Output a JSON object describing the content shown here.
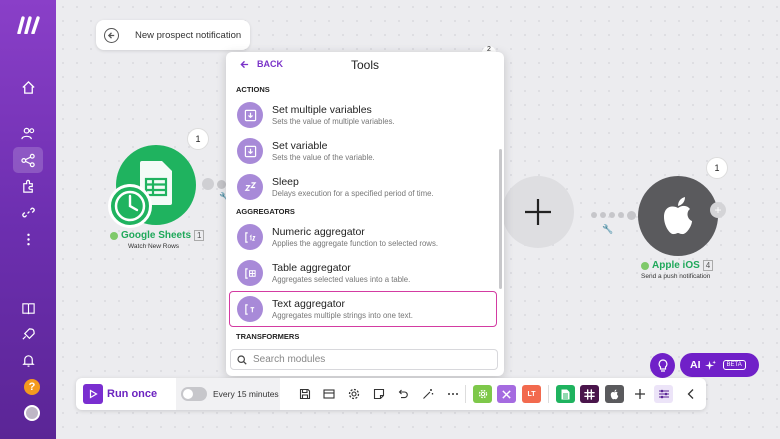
{
  "scenario": {
    "title": "New prospect notification"
  },
  "tools_panel": {
    "back_label": "BACK",
    "title": "Tools",
    "sections": [
      {
        "label": "ACTIONS"
      },
      {
        "label": "AGGREGATORS"
      },
      {
        "label": "TRANSFORMERS"
      }
    ],
    "items": [
      {
        "title": "Set multiple variables",
        "desc": "Sets the value of multiple variables."
      },
      {
        "title": "Set variable",
        "desc": "Sets the value of the variable."
      },
      {
        "title": "Sleep",
        "desc": "Delays execution for a specified period of time."
      },
      {
        "title": "Numeric aggregator",
        "desc": "Applies the aggregate function to selected rows."
      },
      {
        "title": "Table aggregator",
        "desc": "Aggregates selected values into a table."
      },
      {
        "title": "Text aggregator",
        "desc": "Aggregates multiple strings into one text."
      }
    ],
    "selected_item": "Text aggregator",
    "search_placeholder": "Search modules",
    "hidden_badge": "2"
  },
  "nodes": {
    "google_sheets": {
      "name": "Google Sheets",
      "num": "1",
      "sub": "Watch New Rows",
      "badge": "1"
    },
    "apple_ios": {
      "name": "Apple iOS",
      "num": "4",
      "sub": "Send a push notification",
      "badge": "1"
    }
  },
  "ai": {
    "label": "AI",
    "beta": "BETA"
  },
  "toolbar": {
    "run_label": "Run once",
    "schedule_label": "Every 15 minutes",
    "schedule_on": false,
    "rt_label": "LT"
  },
  "colors": {
    "brand": "#7020c8",
    "sheets_green": "#1fb35f",
    "selected_border": "#d33ba2",
    "icon_bg": "#a88ad8"
  }
}
